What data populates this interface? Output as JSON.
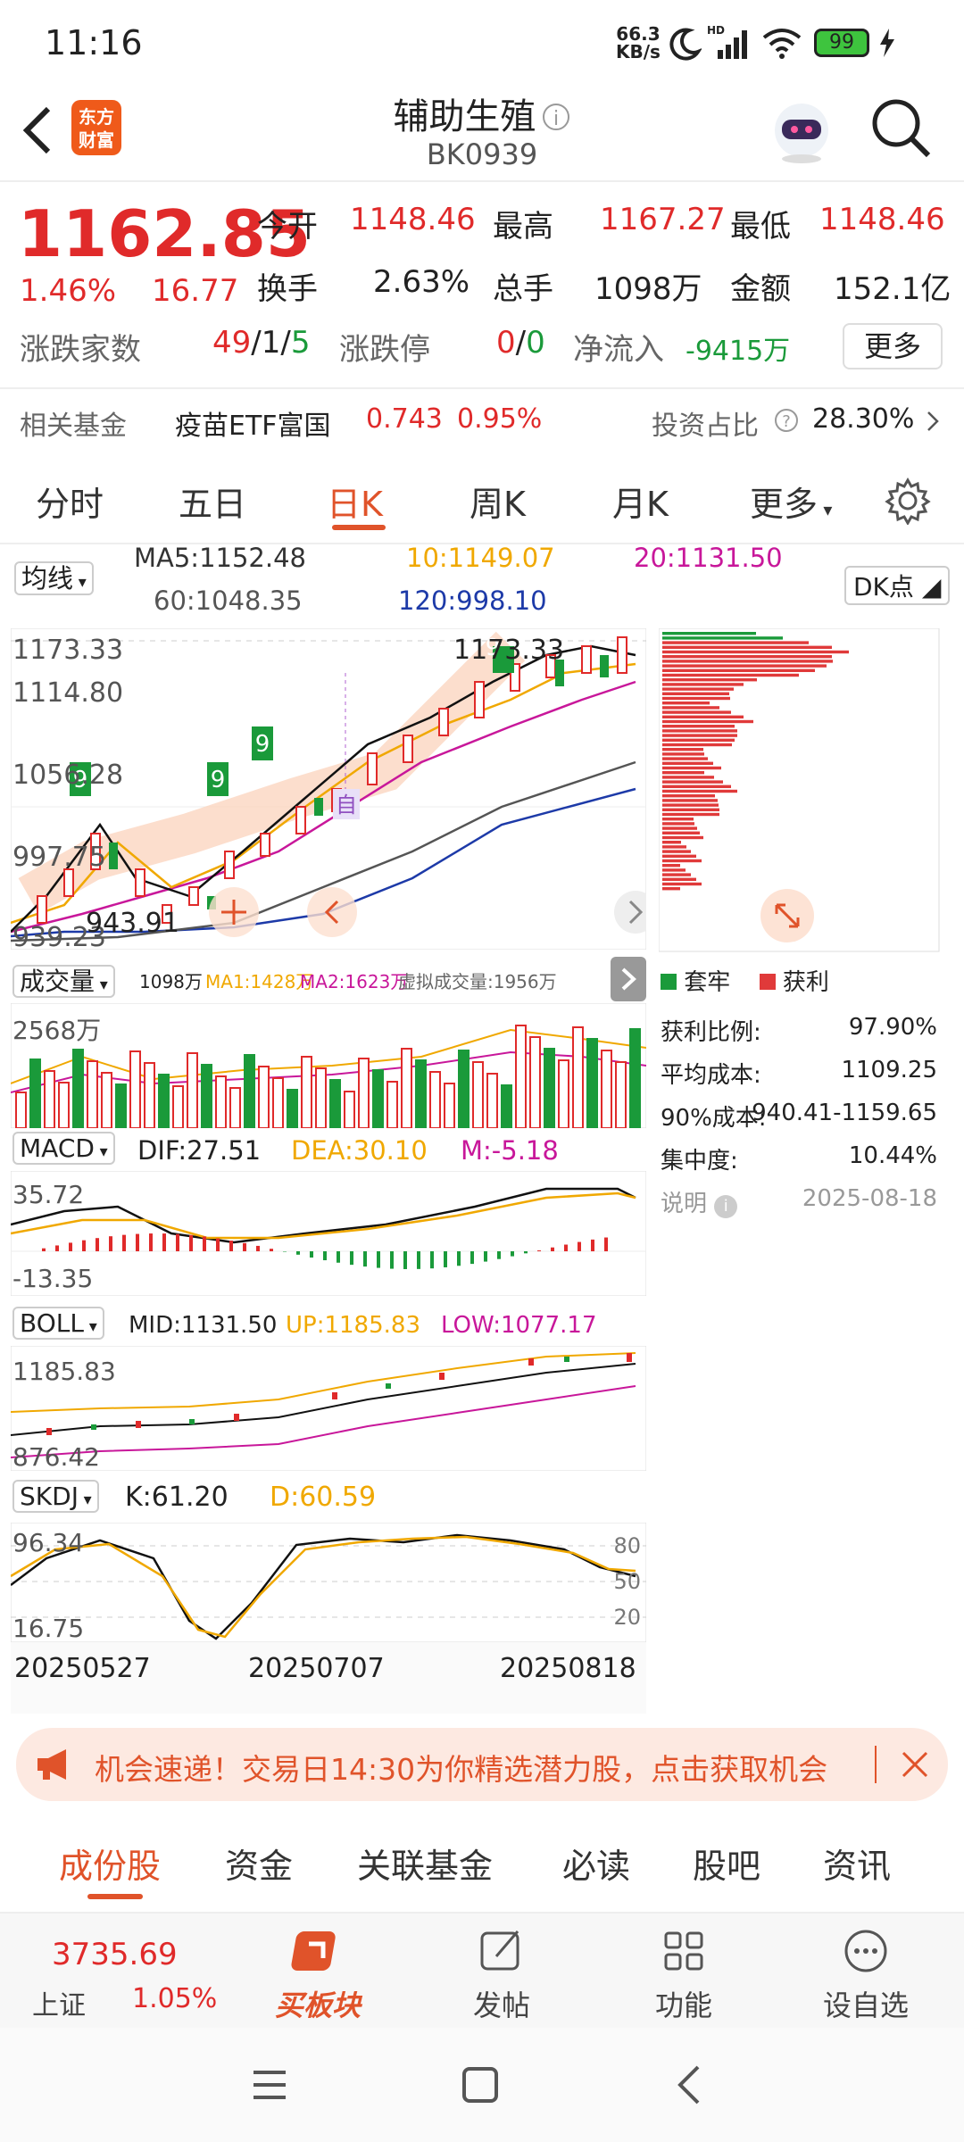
{
  "status_bar": {
    "time": "11:16",
    "net_speed_top": "66.3",
    "net_speed_bottom": "KB/s",
    "battery": "99"
  },
  "header": {
    "logo_line1": "东方",
    "logo_line2": "财富",
    "title": "辅助生殖",
    "code": "BK0939"
  },
  "quote": {
    "price": "1162.85",
    "change_pct": "1.46%",
    "change": "16.77",
    "open_label": "今开",
    "open": "1148.46",
    "high_label": "最高",
    "high": "1167.27",
    "low_label": "最低",
    "low": "1148.46",
    "turnover_label": "换手",
    "turnover": "2.63%",
    "volume_label": "总手",
    "volume": "1098万",
    "amount_label": "金额",
    "amount": "152.1亿",
    "updown_label": "涨跌家数",
    "up": "49",
    "flat": "1",
    "down": "5",
    "limit_label": "涨跌停",
    "limit_up": "0",
    "limit_down": "0",
    "netflow_label": "净流入",
    "netflow": "-9415万",
    "more_button": "更多"
  },
  "fund": {
    "label": "相关基金",
    "name": "疫苗ETF富国",
    "price": "0.743",
    "pct": "0.95%",
    "ratio_label": "投资占比",
    "ratio": "28.30%"
  },
  "period_tabs": [
    "分时",
    "五日",
    "日K",
    "周K",
    "月K",
    "更多"
  ],
  "active_tab": "日K",
  "ma": {
    "selector": "均线",
    "ma5": "MA5:1152.48",
    "ma10": "10:1149.07",
    "ma20": "20:1131.50",
    "ma60": "60:1048.35",
    "ma120": "120:998.10",
    "dk": "DK点"
  },
  "kline": {
    "y1": "1173.33",
    "y2": "1114.80",
    "y3": "1056.28",
    "y4": "997.75",
    "y5": "939.23",
    "high_note": "1173.33",
    "low_note": "943.91",
    "mark": "自"
  },
  "volume_panel": {
    "selector": "成交量",
    "vol": "1098万",
    "ma1": "MA1:1428万",
    "ma2": "MA2:1623万",
    "virtual": "虚拟成交量:1956万",
    "y": "2568万"
  },
  "macd_panel": {
    "selector": "MACD",
    "dif": "DIF:27.51",
    "dea": "DEA:30.10",
    "m": "M:-5.18",
    "y_top": "35.72",
    "y_bottom": "-13.35"
  },
  "boll_panel": {
    "selector": "BOLL",
    "mid": "MID:1131.50",
    "up": "UP:1185.83",
    "low": "LOW:1077.17",
    "y_top": "1185.83",
    "y_bottom": "876.42"
  },
  "skdj_panel": {
    "selector": "SKDJ",
    "k": "K:61.20",
    "d": "D:60.59",
    "y_top": "96.34",
    "y_bottom": "16.75",
    "r80": "80",
    "r50": "50",
    "r20": "20"
  },
  "dates": [
    "20250527",
    "20250707",
    "20250818"
  ],
  "chip": {
    "legend_loss": "套牢",
    "legend_profit": "获利",
    "rows": [
      {
        "label": "获利比例:",
        "value": "97.90%"
      },
      {
        "label": "平均成本:",
        "value": "1109.25"
      },
      {
        "label": "90%成本:",
        "value": "940.41-1159.65"
      },
      {
        "label": "集中度:",
        "value": "10.44%"
      }
    ],
    "note_label": "说明",
    "date": "2025-08-18"
  },
  "banner": {
    "text": "机会速递！交易日14:30为你精选潜力股，点击获取机会"
  },
  "content_tabs": [
    "成份股",
    "资金",
    "关联基金",
    "必读",
    "股吧",
    "资讯"
  ],
  "bottom_nav": {
    "index_value": "3735.69",
    "index_name": "上证",
    "index_pct": "1.05%",
    "items": [
      "买板块",
      "发帖",
      "功能",
      "设自选"
    ]
  },
  "colors": {
    "up": "#e02a2a",
    "down": "#1a9a3a",
    "accent": "#e0532a",
    "ma10": "#f0a800",
    "ma20": "#c8179a",
    "ma120": "#1d3aa8"
  }
}
